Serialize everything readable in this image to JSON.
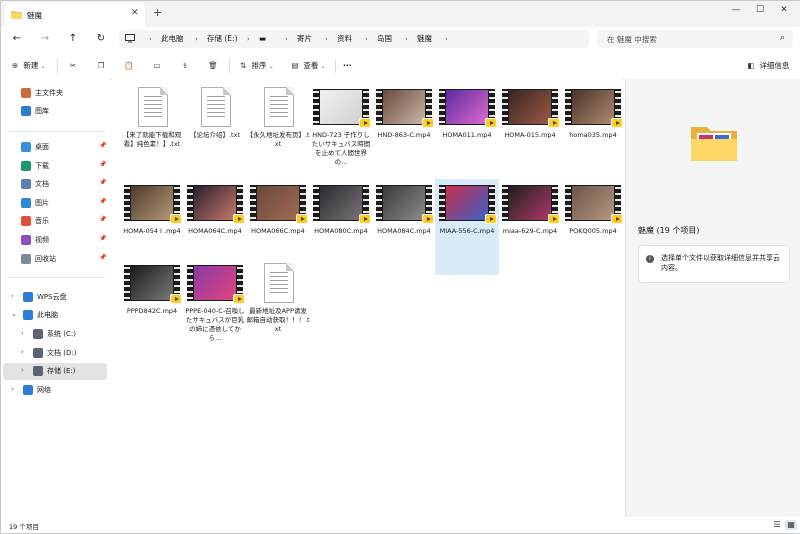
{
  "window": {
    "tab_title": "魅魔",
    "tab_close": "✕",
    "new_tab": "+",
    "controls": {
      "minimize": "—",
      "maximize": "☐",
      "close": "✕"
    }
  },
  "nav": {
    "back": "←",
    "forward": "→",
    "up": "↑",
    "refresh": "↻"
  },
  "breadcrumb": [
    "此电脑",
    "存储 (E:)",
    "▬",
    "寄片",
    "资料",
    "岛国",
    "魅魔"
  ],
  "breadcrumb_separator": "›",
  "search": {
    "placeholder": "在 魅魔 中搜索",
    "icon": "search-icon"
  },
  "toolbar": {
    "new_label": "新建",
    "sort_label": "排序",
    "view_label": "查看",
    "more_label": "···",
    "details_label": "详细信息",
    "dropdown_caret": "⌄"
  },
  "sidebar": {
    "quick": [
      {
        "label": "主文件夹",
        "icon": "home-icon",
        "color": "#d26b3c"
      },
      {
        "label": "图库",
        "icon": "gallery-icon",
        "color": "#2e7cd6"
      }
    ],
    "pinned": [
      {
        "label": "桌面",
        "icon": "desktop-icon",
        "color": "#3a8fdc"
      },
      {
        "label": "下载",
        "icon": "download-icon",
        "color": "#1d9a6c"
      },
      {
        "label": "文档",
        "icon": "documents-icon",
        "color": "#5a7fb0"
      },
      {
        "label": "图片",
        "icon": "pictures-icon",
        "color": "#2f86d6"
      },
      {
        "label": "音乐",
        "icon": "music-icon",
        "color": "#e0533c"
      },
      {
        "label": "视频",
        "icon": "videos-icon",
        "color": "#8a4fc0"
      },
      {
        "label": "回收站",
        "icon": "recycle-bin-icon",
        "color": "#7a8a99"
      }
    ],
    "pin_glyph": "📌",
    "tree": [
      {
        "label": "WPS云盘",
        "icon": "cloud-icon",
        "color": "#2e7cd6",
        "expander": "›",
        "indent": 0
      },
      {
        "label": "此电脑",
        "icon": "computer-icon",
        "color": "#2e7cd6",
        "expander": "⌄",
        "indent": 0
      },
      {
        "label": "系统 (C:)",
        "icon": "drive-icon",
        "color": "#5b6470",
        "expander": "›",
        "indent": 1
      },
      {
        "label": "文档 (D:)",
        "icon": "drive-icon",
        "color": "#5b6470",
        "expander": "›",
        "indent": 1
      },
      {
        "label": "存储 (E:)",
        "icon": "drive-icon",
        "color": "#5b6470",
        "expander": "›",
        "indent": 1,
        "selected": true
      },
      {
        "label": "网络",
        "icon": "network-icon",
        "color": "#2e7cd6",
        "expander": "›",
        "indent": 0
      }
    ]
  },
  "files": [
    {
      "name": "【来了就能下载和观看】纯色素！】.txt",
      "type": "txt"
    },
    {
      "name": "【论坛介绍】.txt",
      "type": "txt"
    },
    {
      "name": "【永久地址发布页】.txt",
      "type": "txt"
    },
    {
      "name": "HND-723 子作りしたいサキュバス時間を止めて人間世界の...",
      "type": "video",
      "colors": [
        "#f2f2f2",
        "#cfcfcf"
      ]
    },
    {
      "name": "HND-863-C.mp4",
      "type": "video",
      "colors": [
        "#6b4a3c",
        "#c9b8a9"
      ]
    },
    {
      "name": "HOMA011.mp4",
      "type": "video",
      "colors": [
        "#5b2a9e",
        "#e06ad0"
      ]
    },
    {
      "name": "HOMA-015.mp4",
      "type": "video",
      "colors": [
        "#3a2420",
        "#9a5b48"
      ]
    },
    {
      "name": "homa035.mp4",
      "type": "video",
      "colors": [
        "#4a332b",
        "#b08a70"
      ]
    },
    {
      "name": "HOMA-054 I .mp4",
      "type": "video",
      "colors": [
        "#4d3a2a",
        "#b89a78"
      ]
    },
    {
      "name": "HOMA064C.mp4",
      "type": "video",
      "colors": [
        "#2a1e2e",
        "#c77a6a"
      ]
    },
    {
      "name": "HOMA066C.mp4",
      "type": "video",
      "colors": [
        "#6a4a3c",
        "#a06a52"
      ]
    },
    {
      "name": "HOMA080C.mp4",
      "type": "video",
      "colors": [
        "#2b2b30",
        "#7a7278"
      ]
    },
    {
      "name": "HOMA084C.mp4",
      "type": "video",
      "colors": [
        "#3a3a3a",
        "#8c8c8c"
      ]
    },
    {
      "name": "MIAA-556-C.mp4",
      "type": "video",
      "colors": [
        "#c92e4a",
        "#3a62c8"
      ],
      "selected": true
    },
    {
      "name": "miaa-629-C.mp4",
      "type": "video",
      "colors": [
        "#1e1e1e",
        "#b03a6a"
      ]
    },
    {
      "name": "POKQ005.mp4",
      "type": "video",
      "colors": [
        "#6a5446",
        "#b89884"
      ]
    },
    {
      "name": "PPPD842C.mp4",
      "type": "video",
      "colors": [
        "#1a1a1a",
        "#7a7a7a"
      ]
    },
    {
      "name": "PPPE-040-C-召喚したサキュバスが巨乳の姉に憑依してから...",
      "type": "video",
      "colors": [
        "#8a3aa8",
        "#e0467a"
      ]
    },
    {
      "name": "最新地址及APP请发邮箱自动获取！！！.txt",
      "type": "txt"
    }
  ],
  "details": {
    "title": "魅魔 (19 个项目)",
    "info_glyph": "i",
    "message": "选择单个文件以获取详细信息并共享云内容。"
  },
  "status": {
    "count": "19 个项目",
    "view_list": "☰",
    "view_tiles": "▦"
  }
}
